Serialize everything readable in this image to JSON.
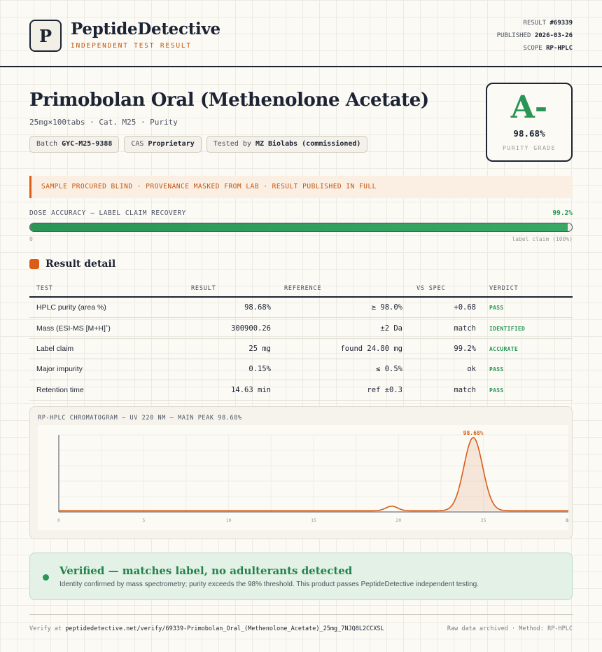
{
  "header": {
    "logo_letter": "P",
    "brand": "PeptideDetective",
    "tagline": "INDEPENDENT TEST RESULT",
    "result_label": "RESULT",
    "result_value": "#69339",
    "published_label": "PUBLISHED",
    "published_value": "2026-03-26",
    "scope_label": "SCOPE",
    "scope_value": "RP-HPLC"
  },
  "product": {
    "title": "Primobolan Oral (Methenolone Acetate)",
    "subtitle": "25mg×100tabs · Cat. M25 · Purity",
    "batch_label": "Batch",
    "batch_value": "GYC-M25-9388",
    "cas_label": "CAS",
    "cas_value": "Proprietary",
    "tested_label": "Tested by",
    "tested_value": "MZ Biolabs (commissioned)"
  },
  "grade": {
    "letter": "A-",
    "percent": "98.68%",
    "label": "PURITY GRADE"
  },
  "banner": "SAMPLE PROCURED BLIND · PROVENANCE MASKED FROM LAB · RESULT PUBLISHED IN FULL",
  "dose": {
    "label": "DOSE ACCURACY — LABEL CLAIM RECOVERY",
    "value": "99.2%",
    "fraction": 0.992,
    "min_label": "0",
    "max_label": "label claim (100%)"
  },
  "section_title": "Result detail",
  "table": {
    "headers": [
      "TEST",
      "RESULT",
      "REFERENCE",
      "VS SPEC",
      "VERDICT"
    ],
    "rows": [
      {
        "test": "HPLC purity (area %)",
        "result": "98.68%",
        "reference": "≥ 98.0%",
        "vs": "+0.68",
        "verdict": "PASS"
      },
      {
        "test": "Mass (ESI-MS [M+H]",
        "test_sup": "+",
        "test_suffix": ")",
        "result": "300900.26",
        "reference": "±2 Da",
        "vs": "match",
        "verdict": "IDENTIFIED"
      },
      {
        "test": "Label claim",
        "result": "25 mg",
        "reference": "found 24.80 mg",
        "vs": "99.2%",
        "verdict": "ACCURATE"
      },
      {
        "test": "Major impurity",
        "result": "0.15%",
        "reference": "≤ 0.5%",
        "vs": "ok",
        "verdict": "PASS"
      },
      {
        "test": "Retention time",
        "result": "14.63 min",
        "reference": "ref ±0.3",
        "vs": "match",
        "verdict": "PASS"
      }
    ]
  },
  "chart_data": {
    "type": "line",
    "title": "RP-HPLC CHROMATOGRAM — UV 220 NM — MAIN PEAK 98.68%",
    "xlabel": "",
    "ylabel": "",
    "xlim": [
      0,
      30
    ],
    "ylim": [
      0,
      100
    ],
    "x_ticks": [
      "0",
      "5",
      "10",
      "15",
      "20",
      "25",
      "30"
    ],
    "x_unit": "min",
    "peaks": [
      {
        "x": 19.6,
        "height": 6,
        "width": 0.35
      },
      {
        "x": 24.4,
        "height": 95,
        "width": 0.55
      }
    ],
    "baseline": 1.5,
    "peak_label": "98.68%",
    "color": "#d95d16"
  },
  "verified": {
    "title": "Verified — matches label, no adulterants detected",
    "text": "Identity confirmed by mass spectrometry; purity exceeds the 98% threshold. This product passes PeptideDetective independent testing."
  },
  "footer": {
    "verify_label": "Verify at",
    "verify_url": "peptidedetective.net/verify/69339-Primobolan_Oral_(Methenolone_Acetate)_25mg_7NJQ8L2CCXSL",
    "right": "Raw data archived · Method: RP-HPLC"
  }
}
